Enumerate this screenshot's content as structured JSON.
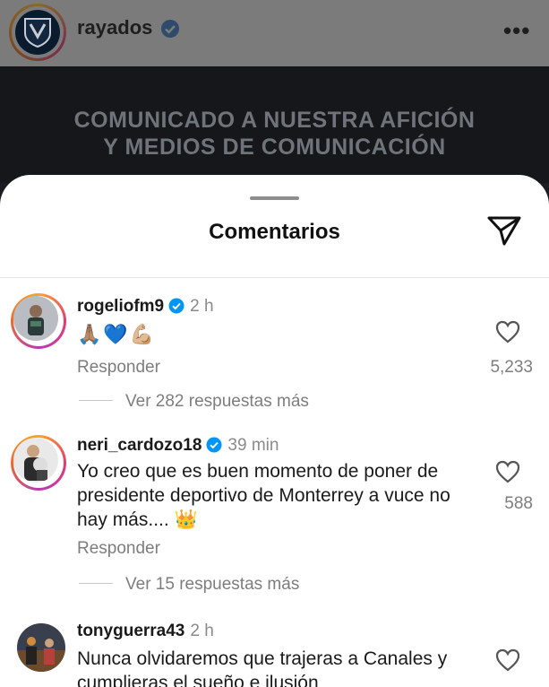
{
  "header": {
    "username": "rayados"
  },
  "post": {
    "headline_line1": "COMUNICADO A NUESTRA AFICIÓN",
    "headline_line2": "Y MEDIOS DE COMUNICACIÓN"
  },
  "sheet": {
    "title": "Comentarios"
  },
  "comments": [
    {
      "user": "rogeliofm9",
      "time": "2 h",
      "text": "🙏🏽💙💪🏼",
      "reply": "Responder",
      "likes": "5,233",
      "more_replies": "Ver 282 respuestas más"
    },
    {
      "user": "neri_cardozo18",
      "time": "39 min",
      "text": "Yo creo que es buen momento de poner de presidente deportivo de Monterrey a vuce no hay más.... 👑",
      "reply": "Responder",
      "likes": "588",
      "more_replies": "Ver 15 respuestas más"
    },
    {
      "user": "tonyguerra43",
      "time": "2 h",
      "text": "Nunca olvidaremos que trajeras a Canales y cumplieras el sueño e ilusión"
    }
  ],
  "colors": {
    "verified": "#0095f6",
    "bg_sheet": "#ffffff",
    "muted_text": "#7d7d7d"
  }
}
